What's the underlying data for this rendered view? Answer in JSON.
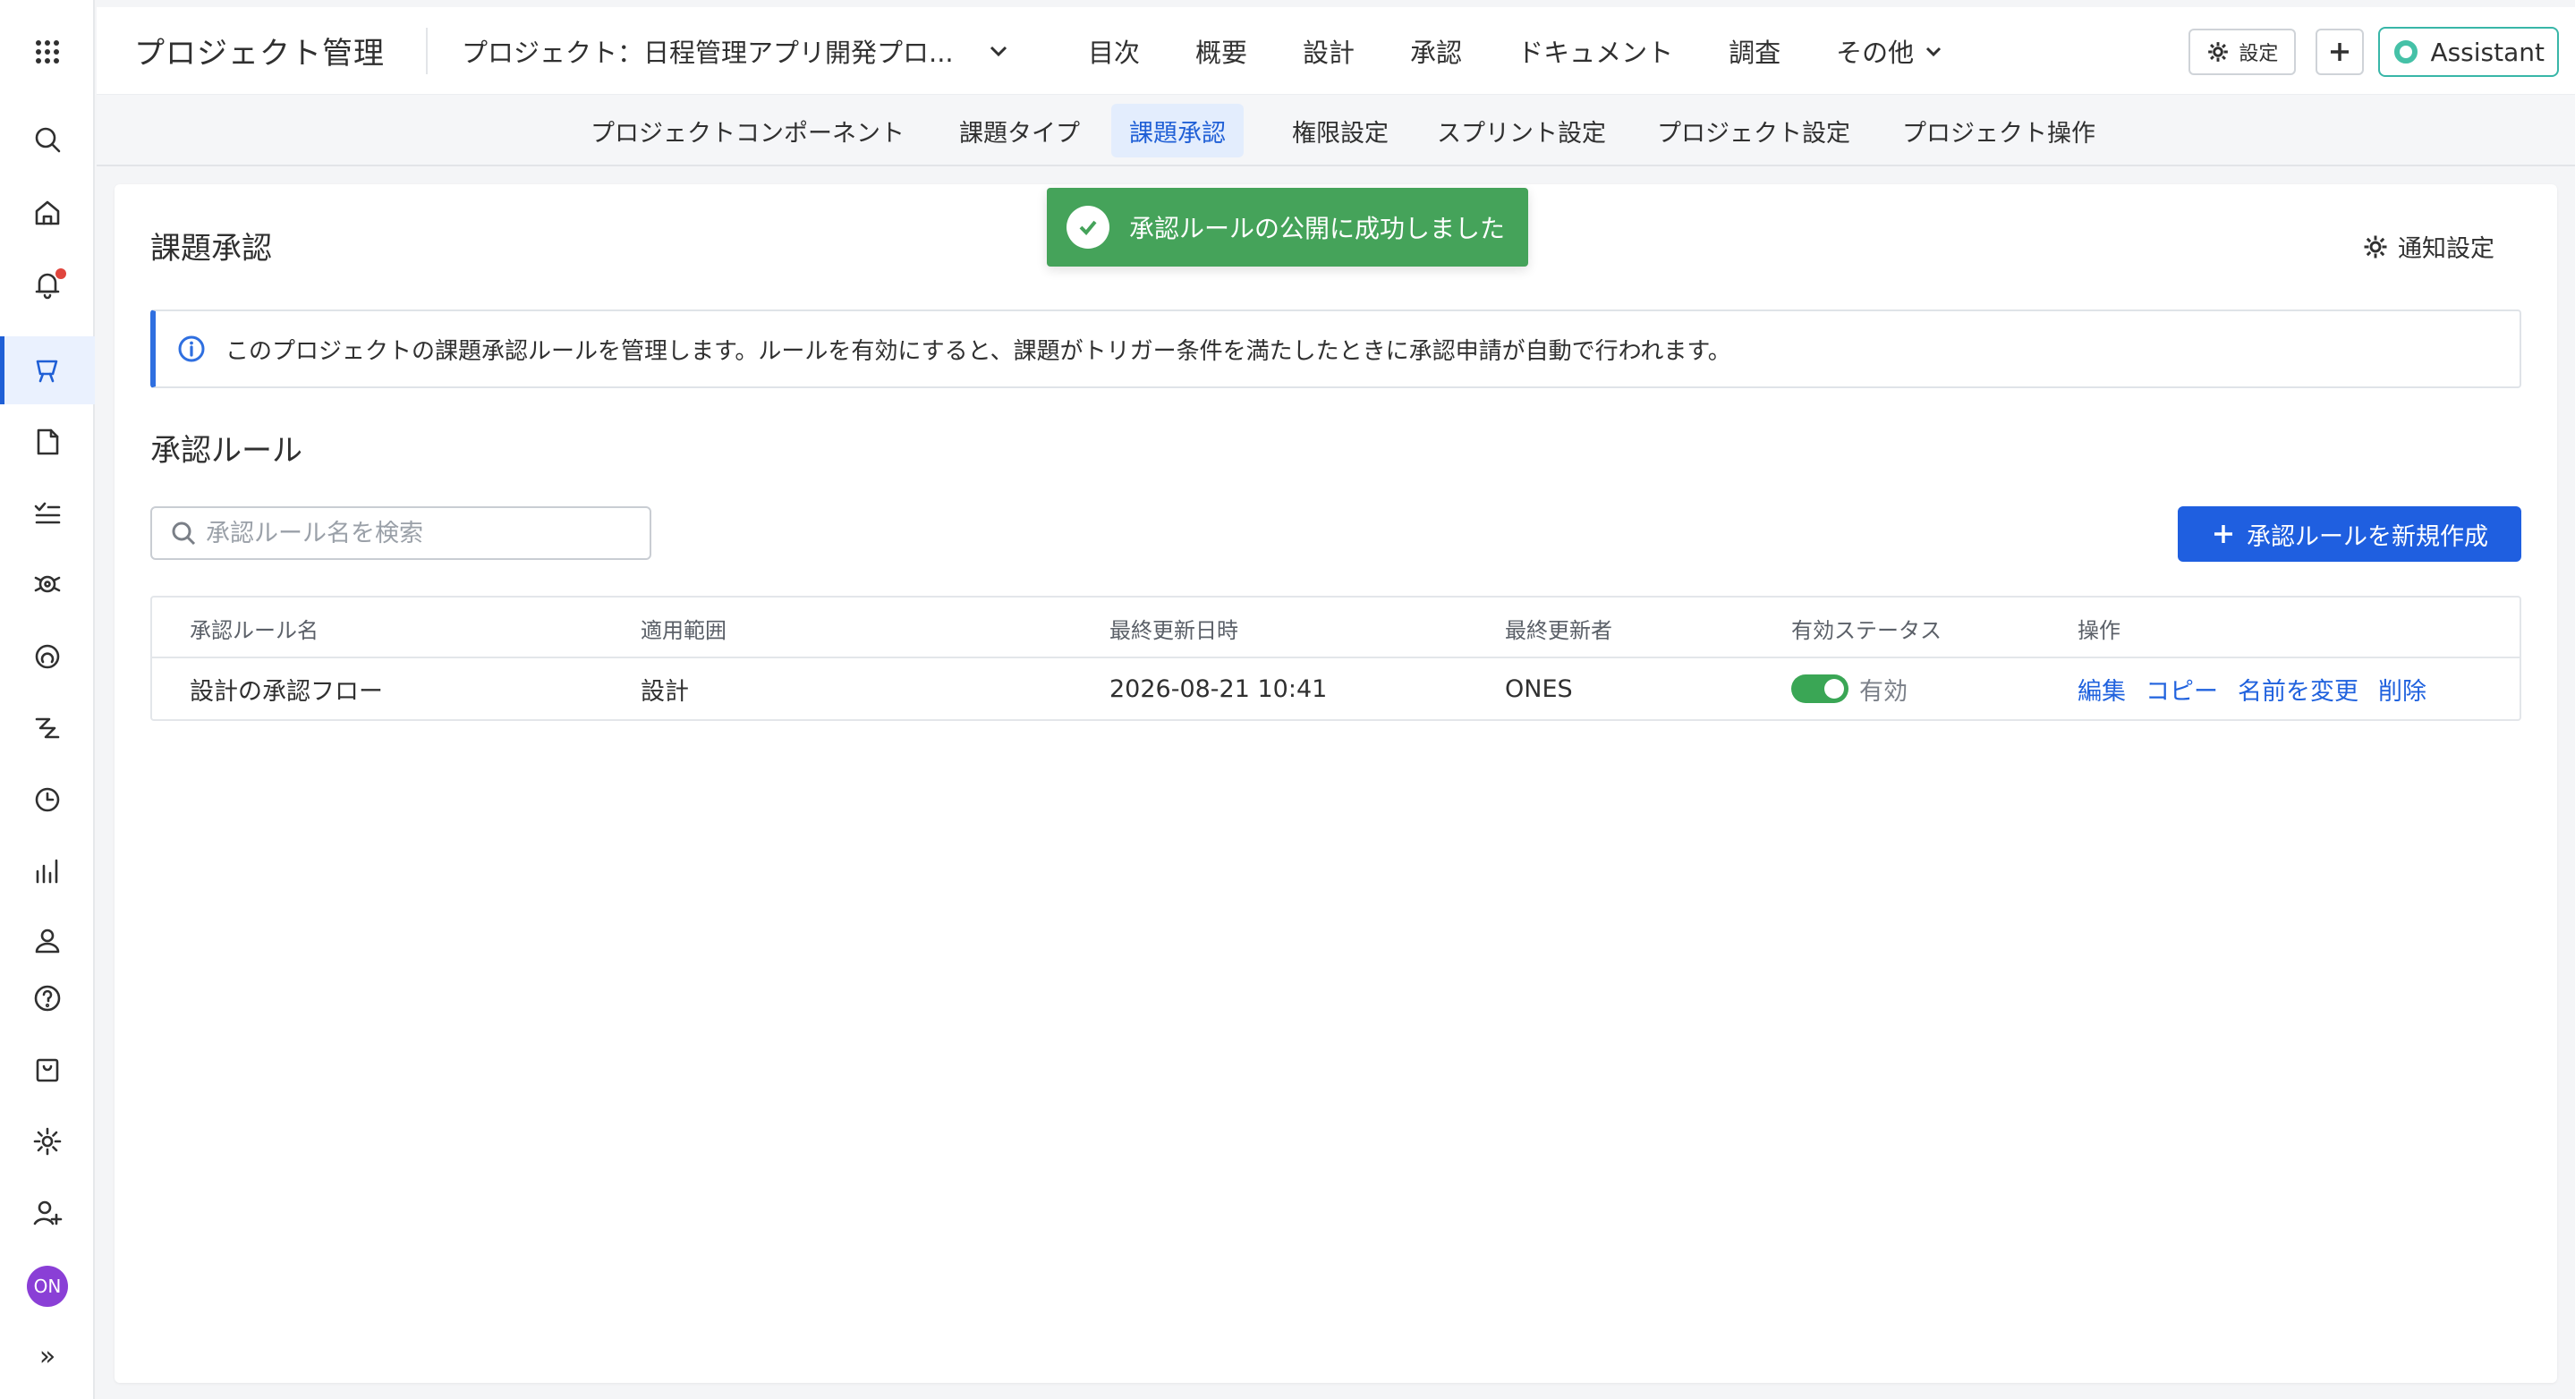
{
  "header": {
    "app_title": "プロジェクト管理",
    "project_selector": "プロジェクト：日程管理アプリ開発プロ...",
    "nav": [
      "目次",
      "概要",
      "設計",
      "承認",
      "ドキュメント",
      "調査"
    ],
    "nav_more": "その他",
    "settings_label": "設定",
    "assistant_label": "Assistant"
  },
  "subnav": {
    "tabs": [
      "プロジェクトコンポーネント",
      "課題タイプ",
      "課題承認",
      "権限設定",
      "スプリント設定",
      "プロジェクト設定",
      "プロジェクト操作"
    ],
    "active": "課題承認"
  },
  "sidebar": {
    "icons": [
      "apps-grid-icon",
      "search-icon",
      "home-icon",
      "bell-icon",
      "project-icon",
      "document-icon",
      "task-list-icon",
      "bug-icon",
      "dashboard-icon",
      "timeline-icon",
      "clock-icon",
      "report-icon",
      "user-icon",
      "help-icon",
      "box-icon",
      "gear-icon",
      "add-user-icon"
    ],
    "avatar": "ON",
    "expand": "»"
  },
  "toast": {
    "message": "承認ルールの公開に成功しました",
    "color": "#45a35a"
  },
  "main": {
    "title": "課題承認",
    "notify_settings": "通知設定",
    "info_text": "このプロジェクトの課題承認ルールを管理します。ルールを有効にすると、課題がトリガー条件を満たしたときに承認申請が自動で行われます。",
    "section_title": "承認ルール",
    "search_placeholder": "承認ルール名を検索",
    "create_button": "承認ルールを新規作成",
    "table": {
      "headers": [
        "承認ルール名",
        "適用範囲",
        "最終更新日時",
        "最終更新者",
        "有効ステータス",
        "操作"
      ],
      "rows": [
        {
          "name": "設計の承認フロー",
          "scope": "設計",
          "updated_at": "2026-08-21 10:41",
          "updated_by": "ONES",
          "enabled": true,
          "status_label": "有効",
          "actions": [
            "編集",
            "コピー",
            "名前を変更",
            "削除"
          ]
        }
      ]
    }
  },
  "colors": {
    "accent": "#1f5fe0",
    "success": "#45a35a",
    "info_border": "#2f6fe0",
    "assistant_ring": "#45c1a7"
  }
}
